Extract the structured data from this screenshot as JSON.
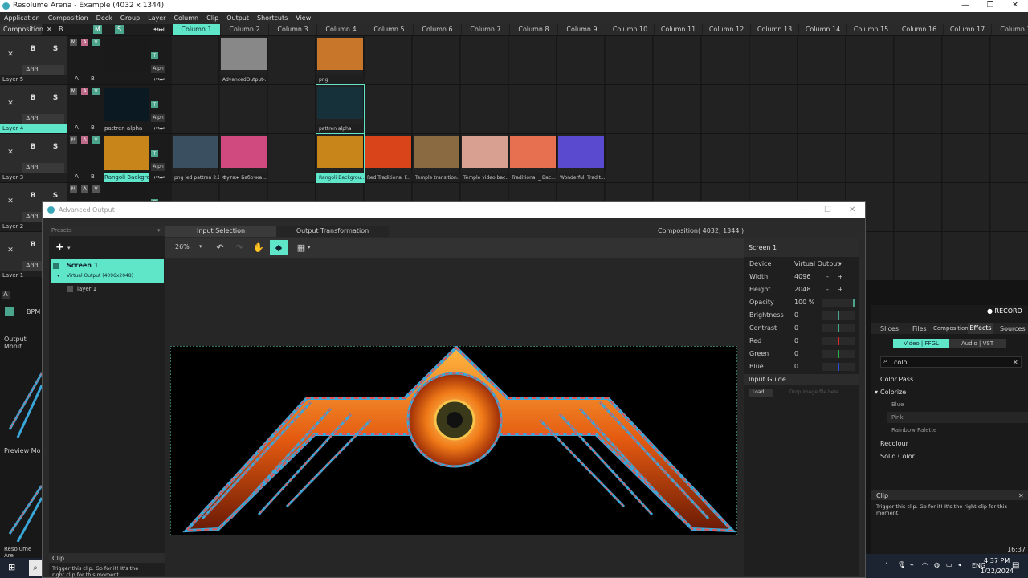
{
  "window": {
    "title": "Resolume Arena - Example (4032 x 1344)",
    "min": "—",
    "max": "❐",
    "close": "✕"
  },
  "menu": [
    "Application",
    "Composition",
    "Deck",
    "Group",
    "Layer",
    "Column",
    "Clip",
    "Output",
    "Shortcuts",
    "View"
  ],
  "composition_bar": {
    "label": "Composition",
    "x": "✕",
    "b": "B",
    "m": "M",
    "s": "S"
  },
  "columns": [
    "Column 1",
    "Column 2",
    "Column 3",
    "Column 4",
    "Column 5",
    "Column 6",
    "Column 7",
    "Column 8",
    "Column 9",
    "Column 10",
    "Column 11",
    "Column 12",
    "Column 13",
    "Column 14",
    "Column 15",
    "Column 16",
    "Column 17",
    "Column 1"
  ],
  "layers": [
    {
      "name": "Layer 5",
      "add": "Add",
      "clip_name": "",
      "clips": [
        {
          "col": 1,
          "label": "AdvancedOutput-..."
        },
        {
          "col": 3,
          "label": "png"
        }
      ]
    },
    {
      "name": "Layer 4",
      "add": "Add",
      "clip_name": "pattren alpha",
      "clips": [
        {
          "col": 3,
          "label": "pattren alpha"
        }
      ]
    },
    {
      "name": "Layer 3",
      "add": "Add",
      "clip_name": "Rangoli Backgrou...",
      "clips": [
        {
          "col": 0,
          "label": "png led pattren 2.1"
        },
        {
          "col": 1,
          "label": "Футаж Бабочка ..."
        },
        {
          "col": 3,
          "label": "Rangoli Backgrou..."
        },
        {
          "col": 4,
          "label": "Red Traditional F..."
        },
        {
          "col": 5,
          "label": "Temple transition..."
        },
        {
          "col": 6,
          "label": "Temple video bac..."
        },
        {
          "col": 7,
          "label": "Traditional _ Bac..."
        },
        {
          "col": 8,
          "label": "Wonderfull Tradit..."
        }
      ]
    },
    {
      "name": "Layer 2",
      "add": "Add",
      "clip_name": "",
      "clips": []
    },
    {
      "name": "Layer 1",
      "add": "Add",
      "clip_name": "",
      "clips": []
    }
  ],
  "layer_buttons": {
    "x": "✕",
    "b": "B",
    "s": "S",
    "m": "M",
    "a": "A",
    "v": "V",
    "t": "T",
    "alph": "Alph",
    "ab_a": "A",
    "ab_b": "B"
  },
  "left_strip": {
    "a": "A",
    "bpm": "BPM",
    "output_monitor": "Output Monit",
    "preview": "Preview Mo",
    "resolume": "Resolume Are"
  },
  "dialog": {
    "title": "Advanced Output",
    "composition_info": "Composition( 4032, 1344 )",
    "presets": "Presets",
    "tabs": [
      "Input Selection",
      "Output Transformation"
    ],
    "zoom": "26%",
    "screen": {
      "name": "Screen 1",
      "sub": "Virtual Output (4096x2048)",
      "layer": "layer 1"
    },
    "clip_title": "Clip",
    "clip_hint": "Trigger this clip. Go for it! It's the right clip for this moment.",
    "props": {
      "header": "Screen 1",
      "rows": [
        {
          "label": "Device",
          "value": "Virtual Output"
        },
        {
          "label": "Width",
          "value": "4096"
        },
        {
          "label": "Height",
          "value": "2048"
        },
        {
          "label": "Opacity",
          "value": "100 %"
        },
        {
          "label": "Brightness",
          "value": "0"
        },
        {
          "label": "Contrast",
          "value": "0"
        },
        {
          "label": "Red",
          "value": "0"
        },
        {
          "label": "Green",
          "value": "0"
        },
        {
          "label": "Blue",
          "value": "0"
        }
      ],
      "input_guide": "Input Guide",
      "load": "Load...",
      "drop": "Drop image file here."
    }
  },
  "right_panel": {
    "record": "RECORD",
    "tabs": [
      "Slices",
      "Files",
      "Compositions",
      "Effects",
      "Sources"
    ],
    "subtabs": [
      "Video | FFGL",
      "Audio | VST"
    ],
    "search": "colo",
    "effects": [
      "Color Pass",
      "Colorize",
      "Blue",
      "Pink",
      "Rainbow Palette",
      "Recolour",
      "Solid Color"
    ],
    "clip_title": "Clip",
    "clip_hint": "Trigger this clip. Go for it! It's the right clip for this moment.",
    "time": "16:37"
  },
  "taskbar": {
    "lang": "ENG",
    "time": "4:37 PM",
    "date": "1/22/2024"
  },
  "colors": {
    "accent": "#5fe6c8",
    "outline_blue": "#3aa7d9",
    "outline_red": "#e05555"
  }
}
